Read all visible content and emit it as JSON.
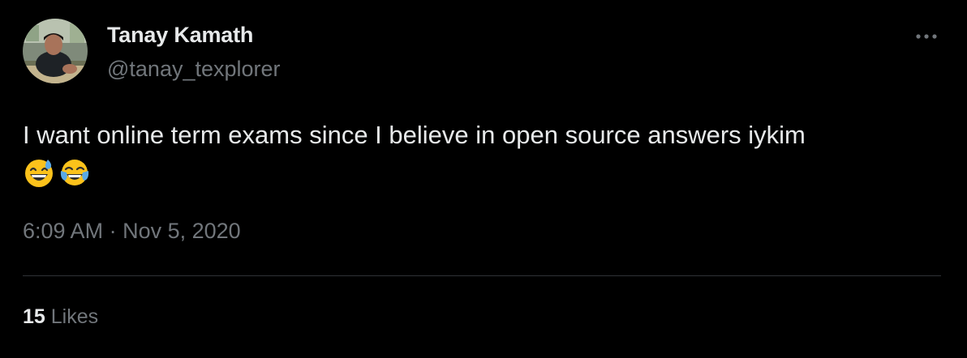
{
  "tweet": {
    "author": {
      "display_name": "Tanay Kamath",
      "handle": "@tanay_texplorer"
    },
    "avatar_icon": "profile-photo",
    "more_icon": "more-options-icon",
    "text": "I want online term exams since I believe in open source answers iykim",
    "emojis": [
      "grinning-face-with-sweat-emoji",
      "face-with-tears-of-joy-emoji"
    ],
    "time": "6:09 AM",
    "separator": "·",
    "date": "Nov 5, 2020",
    "likes_count": "15",
    "likes_label": "Likes",
    "colors": {
      "background": "#000000",
      "primary_text": "#e7e9ea",
      "secondary_text": "#71767b",
      "divider": "#2f3336"
    }
  }
}
